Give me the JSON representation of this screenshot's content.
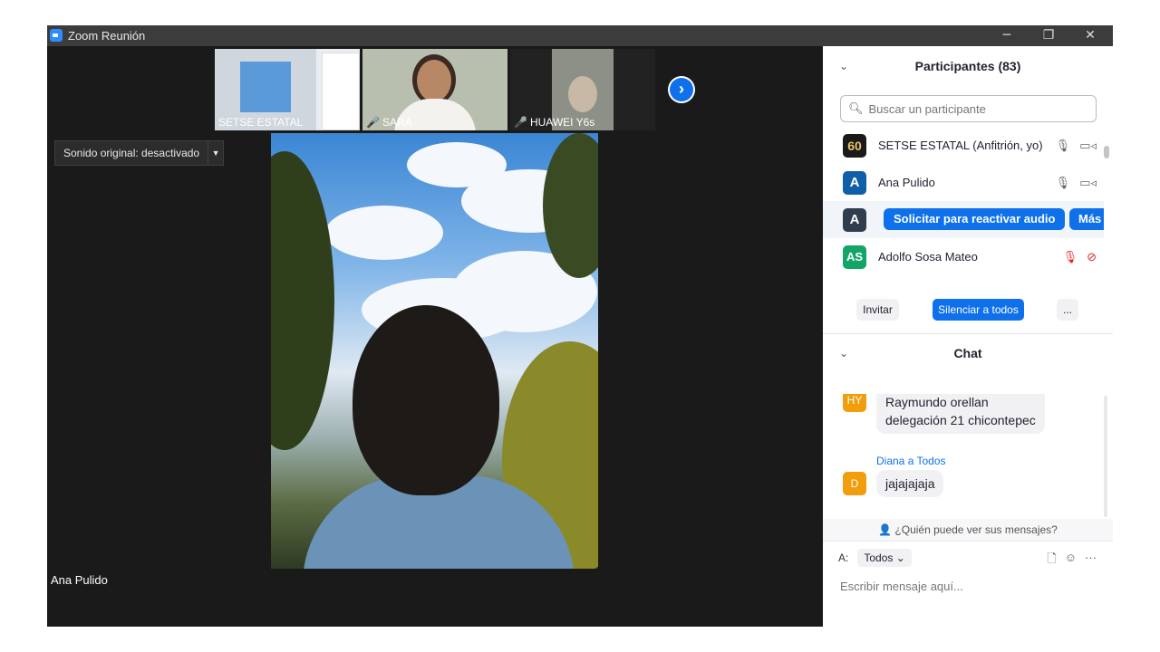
{
  "window": {
    "title": "Zoom Reunión",
    "controls": [
      "─",
      "❐",
      "✕"
    ]
  },
  "thumbnails": [
    {
      "name": "SETSE ESTATAL",
      "muted": false
    },
    {
      "name": "SARA",
      "muted": true
    },
    {
      "name": "HUAWEI Y6s",
      "muted": true
    }
  ],
  "video": {
    "sound_button": "Sonido original: desactivado",
    "speaker_name": "Ana Pulido"
  },
  "participants": {
    "header": "Participantes (83)",
    "search_placeholder": "Buscar un participante",
    "list": [
      {
        "initials": "60",
        "name": "SETSE ESTATAL (Anfitrión, yo)",
        "color": "#1a1a1a",
        "mic": "on",
        "cam": "on"
      },
      {
        "initials": "A",
        "name": "Ana Pulido",
        "color": "#0f5ea8",
        "mic": "on",
        "cam": "on"
      },
      {
        "initials": "A",
        "name": "",
        "color": "#2f3d4c",
        "hover_actions": [
          "Solicitar para reactivar audio",
          "Más"
        ]
      },
      {
        "initials": "AS",
        "name": "Adolfo Sosa Mateo",
        "color": "#13a566",
        "mic": "muted",
        "cam": "off"
      }
    ],
    "invite_label": "Invitar",
    "mute_all_label": "Silenciar a todos",
    "more_label": "..."
  },
  "chat": {
    "header": "Chat",
    "messages": [
      {
        "avatar": "HY",
        "text_line1": "Raymundo orellan",
        "text_line2": "delegación 21 chicontepec"
      },
      {
        "sender": "Diana a Todos",
        "avatar": "D",
        "text": "jajajajaja"
      }
    ],
    "who_sees": "¿Quién puede ver sus mensajes?",
    "to_label": "A:",
    "to_value": "Todos",
    "input_placeholder": "Escribir mensaje aquí...",
    "accent_color": "#0e71eb"
  }
}
